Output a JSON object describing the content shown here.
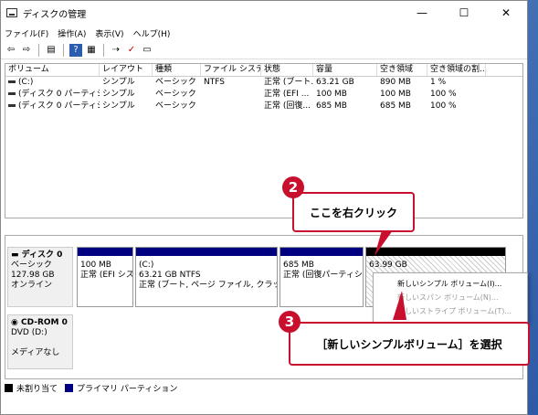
{
  "window": {
    "title": "ディスクの管理",
    "controls": {
      "minimize": "—",
      "maximize": "☐",
      "close": "✕"
    }
  },
  "menu": [
    "ファイル(F)",
    "操作(A)",
    "表示(V)",
    "ヘルプ(H)"
  ],
  "toolbar": [
    "back-icon",
    "forward-icon",
    "view-icon",
    "help-icon",
    "properties-icon",
    "connect-icon",
    "check-icon",
    "window-icon"
  ],
  "volume_table": {
    "columns": [
      "ボリューム",
      "レイアウト",
      "種類",
      "ファイル システム",
      "状態",
      "容量",
      "空き領域",
      "空き領域の割..."
    ],
    "rows": [
      [
        "(C:)",
        "シンプル",
        "ベーシック",
        "NTFS",
        "正常 (ブート...",
        "63.21 GB",
        "890 MB",
        "1 %"
      ],
      [
        "(ディスク 0 パーティシ...",
        "シンプル",
        "ベーシック",
        "",
        "正常 (EFI ...",
        "100 MB",
        "100 MB",
        "100 %"
      ],
      [
        "(ディスク 0 パーティシ...",
        "シンプル",
        "ベーシック",
        "",
        "正常 (回復...",
        "685 MB",
        "685 MB",
        "100 %"
      ]
    ]
  },
  "disk0": {
    "name": "ディスク 0",
    "type": "ベーシック",
    "size": "127.98 GB",
    "status": "オンライン",
    "partitions": [
      {
        "line1": "100 MB",
        "line2": "正常 (EFI シス"
      },
      {
        "line1": "(C:)",
        "line2": "63.21 GB NTFS",
        "line3": "正常 (ブート, ページ ファイル, クラッシュ ダ"
      },
      {
        "line1": "685 MB",
        "line2": "正常 (回復パーティショ"
      },
      {
        "line1": "63.99 GB"
      }
    ]
  },
  "cdrom": {
    "name": "CD-ROM 0",
    "type": "DVD (D:)",
    "status": "メディアなし"
  },
  "legend": {
    "unallocated": "未割り当て",
    "primary": "プライマリ パーティション"
  },
  "context_menu": [
    "新しいシンプル ボリューム(I)...",
    "新しいスパン ボリューム(N)...",
    "新しいストライプ ボリューム(T)..."
  ],
  "callouts": {
    "step2_num": "2",
    "step2_text": "ここを右クリック",
    "step3_num": "3",
    "step3_text": "［新しいシンプルボリューム］を選択"
  },
  "colors": {
    "accent": "#c8102e",
    "primary_bar": "#000080"
  }
}
